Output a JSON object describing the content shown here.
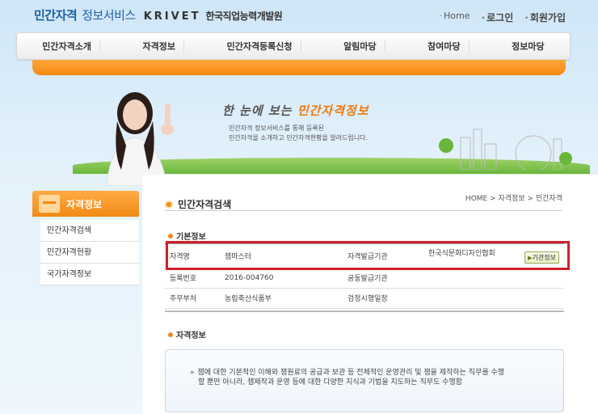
{
  "header": {
    "logo_main": "민간자격",
    "logo_sub": "정보서비스",
    "logo_krivet": "KRIVET",
    "logo_org": "한국직업능력개발원",
    "links": {
      "home": "Home",
      "login": "로그인",
      "signup": "회원가입"
    }
  },
  "nav": {
    "items": [
      "민간자격소개",
      "자격정보",
      "민간자격등록신청",
      "알림마당",
      "참여마당",
      "정보마당"
    ]
  },
  "banner": {
    "title_prefix": "한 눈에 보는",
    "title_highlight": "민간자격정보",
    "desc_line1": "민간자격 정보서비스를 통해 등록된",
    "desc_line2": "민간자격을 소개하고 민간자격현황을 알려드립니다."
  },
  "sidebar": {
    "title": "자격정보",
    "items": [
      "민간자격검색",
      "민간자격현황",
      "국가자격정보"
    ]
  },
  "main": {
    "page_title": "민간자격검색",
    "breadcrumb": "HOME > 자격정보 > 민간자격",
    "basic_info": {
      "heading": "기본정보",
      "rows": [
        {
          "label1": "자격명",
          "value1": "잼마스터",
          "label2": "자격발급기관",
          "value2": "한국식문화디자인협회"
        },
        {
          "label1": "등록번호",
          "value1": "2016-004760",
          "label2": "공동발급기관",
          "value2": ""
        },
        {
          "label1": "주무부처",
          "value1": "농림축산식품부",
          "label2": "검정시행일정",
          "value2": ""
        }
      ],
      "org_button": "기관정보"
    },
    "qual_info": {
      "heading": "자격정보",
      "arrow": "»",
      "line1": "잼에 대한 기본적인 이해와 잼원료의 공급과 보관 등 전체적인 운영관리 및 잼을 제작하는 직무를 수행",
      "line2": "할 뿐만 아니라, 잼제작과 운영 등에 대한 다양한 지식과 기법을 지도하는 직무도 수행함"
    }
  },
  "colors": {
    "accent_orange": "#f18a14",
    "logo_blue": "#1f5fa8",
    "highlight_red": "#d0202a"
  }
}
